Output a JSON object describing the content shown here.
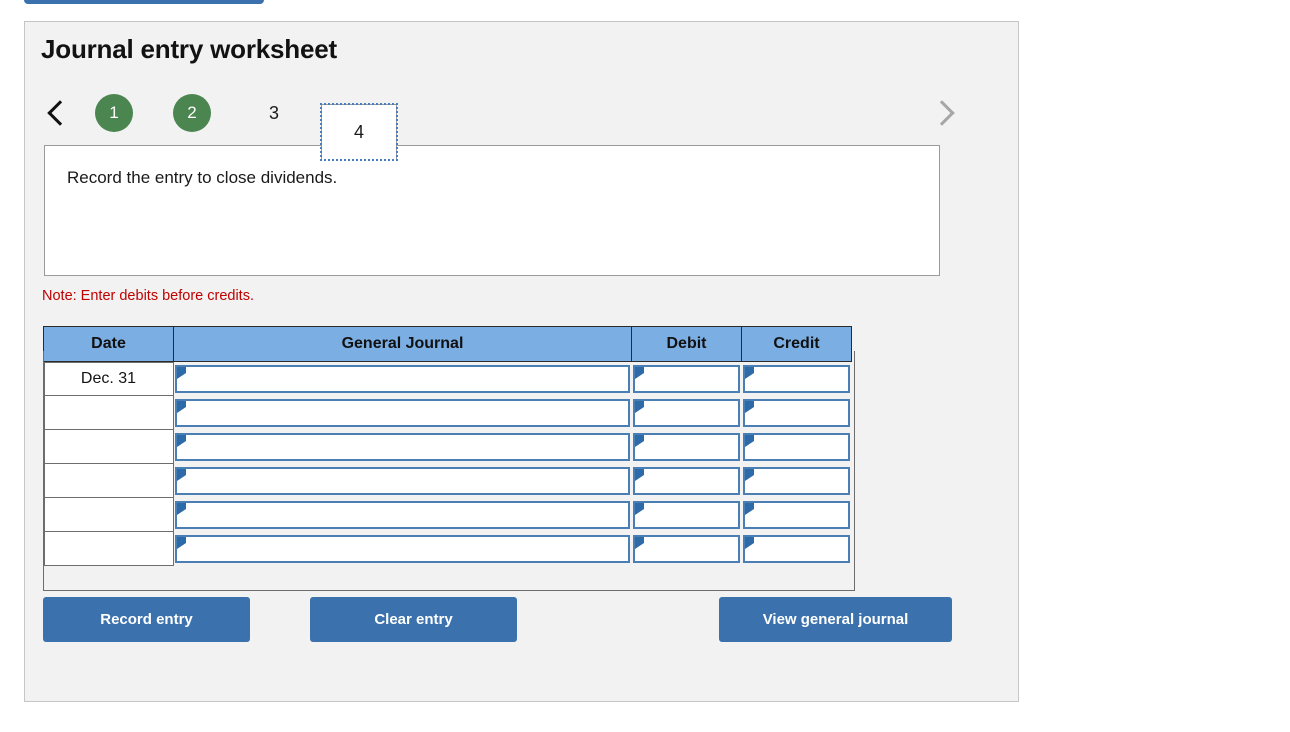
{
  "colors": {
    "panel_bg": "#f2f2f2",
    "panel_border": "#c6c6c6",
    "accent_button": "#3b72ae",
    "step_done": "#4b8550",
    "table_header": "#7bafe4",
    "input_border": "#4a7fb5",
    "note_red": "#c00000",
    "focus_outline": "#4a7ebb"
  },
  "top_cut_button": {
    "label": ""
  },
  "panel": {
    "title": "Journal entry worksheet"
  },
  "pager": {
    "prev_icon": "chevron-left-icon",
    "next_icon": "chevron-right-icon",
    "steps": [
      {
        "label": "1",
        "state": "done"
      },
      {
        "label": "2",
        "state": "done"
      },
      {
        "label": "3",
        "state": "plain"
      },
      {
        "label": "4",
        "state": "active"
      }
    ]
  },
  "instruction": {
    "text": "Record the entry to close dividends."
  },
  "note": {
    "text": "Note: Enter debits before credits."
  },
  "journal": {
    "columns": [
      {
        "key": "date",
        "label": "Date"
      },
      {
        "key": "gj",
        "label": "General Journal"
      },
      {
        "key": "debit",
        "label": "Debit"
      },
      {
        "key": "credit",
        "label": "Credit"
      }
    ],
    "rows": [
      {
        "date": "Dec. 31",
        "gj": "",
        "debit": "",
        "credit": ""
      },
      {
        "date": "",
        "gj": "",
        "debit": "",
        "credit": ""
      },
      {
        "date": "",
        "gj": "",
        "debit": "",
        "credit": ""
      },
      {
        "date": "",
        "gj": "",
        "debit": "",
        "credit": ""
      },
      {
        "date": "",
        "gj": "",
        "debit": "",
        "credit": ""
      },
      {
        "date": "",
        "gj": "",
        "debit": "",
        "credit": ""
      }
    ]
  },
  "actions": {
    "record": "Record entry",
    "clear": "Clear entry",
    "view": "View general journal"
  }
}
